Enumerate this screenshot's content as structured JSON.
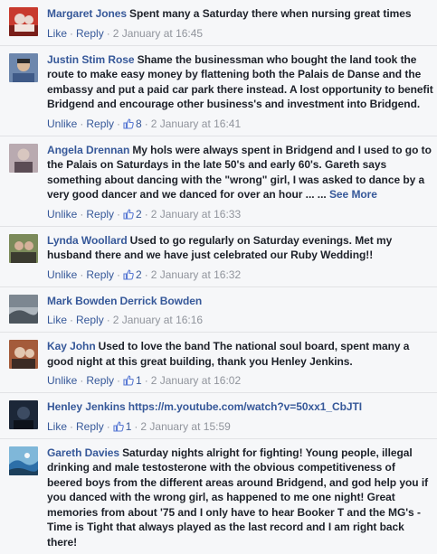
{
  "comments": [
    {
      "author": "Margaret Jones",
      "text": "Spent many a Saturday there when nursing great times",
      "action1": "Like",
      "action2": "Reply",
      "likes": "",
      "timestamp": "2 January at 16:45",
      "avatar_colors": [
        "#c83a2e",
        "#e9d7cf",
        "#7a1f1a"
      ]
    },
    {
      "author": "Justin Stim Rose",
      "text": "Shame the businessman who bought the land took the route to make easy money by flattening both the Palais de Danse and the embassy and put a paid car park there instead. A lost opportunity to benefit Bridgend and encourage other business's and investment into Bridgend.",
      "action1": "Unlike",
      "action2": "Reply",
      "likes": "8",
      "timestamp": "2 January at 16:41",
      "avatar_colors": [
        "#3f5a87",
        "#d9b99a",
        "#2b2b2b"
      ]
    },
    {
      "author": "Angela Drennan",
      "text": "My hols were always spent in Bridgend and I used to go to the Palais on Saturdays in the late 50's and early 60's. Gareth says something about dancing with the \"wrong\" girl, I was asked to dance by a very good dancer and we danced for over an hour ... ...",
      "see_more": "See More",
      "action1": "Unlike",
      "action2": "Reply",
      "likes": "2",
      "timestamp": "2 January at 16:33",
      "avatar_colors": [
        "#b9aab0",
        "#d8c7c0",
        "#5b4c55"
      ]
    },
    {
      "author": "Lynda Woollard",
      "text": "Used to go regularly on Saturday evenings. Met my husband there and we have just celebrated our Ruby Wedding!!",
      "action1": "Unlike",
      "action2": "Reply",
      "likes": "2",
      "timestamp": "2 January at 16:32",
      "avatar_colors": [
        "#7b8a5a",
        "#d5b19a",
        "#3b3b30"
      ]
    },
    {
      "author": "Mark Bowden",
      "text": "",
      "mention": "Derrick Bowden",
      "action1": "Like",
      "action2": "Reply",
      "likes": "",
      "timestamp": "2 January at 16:16",
      "avatar_colors": [
        "#7d8791",
        "#aeb6bd",
        "#4d565e"
      ]
    },
    {
      "author": "Kay John",
      "text": "Used to love the band The national soul board, spent many a good night at this great building, thank you Henley Jenkins.",
      "action1": "Unlike",
      "action2": "Reply",
      "likes": "1",
      "timestamp": "2 January at 16:02",
      "avatar_colors": [
        "#a45b3b",
        "#e2c7b0",
        "#3c2b24"
      ]
    },
    {
      "author": "Henley Jenkins",
      "text": "",
      "link": "https://m.youtube.com/watch?v=50xx1_CbJTI",
      "action1": "Like",
      "action2": "Reply",
      "likes": "1",
      "timestamp": "2 January at 15:59",
      "avatar_colors": [
        "#1c2738",
        "#3c4b62",
        "#0d121b"
      ]
    },
    {
      "author": "Gareth Davies",
      "text": "Saturday nights alright for fighting! Young people, illegal drinking and male testosterone with the obvious competitiveness of beered boys from the different areas around Bridgend, and god help you if you danced with the wrong girl, as happened to me one night! Great memories from about '75 and I only have to hear Booker T and the MG's - Time is Tight that always played as the last record and I am right back there!",
      "action1": "",
      "action2": "",
      "likes": "",
      "timestamp": "",
      "avatar_colors": [
        "#2d6fa8",
        "#7fb7d9",
        "#1c3f5c"
      ]
    }
  ]
}
